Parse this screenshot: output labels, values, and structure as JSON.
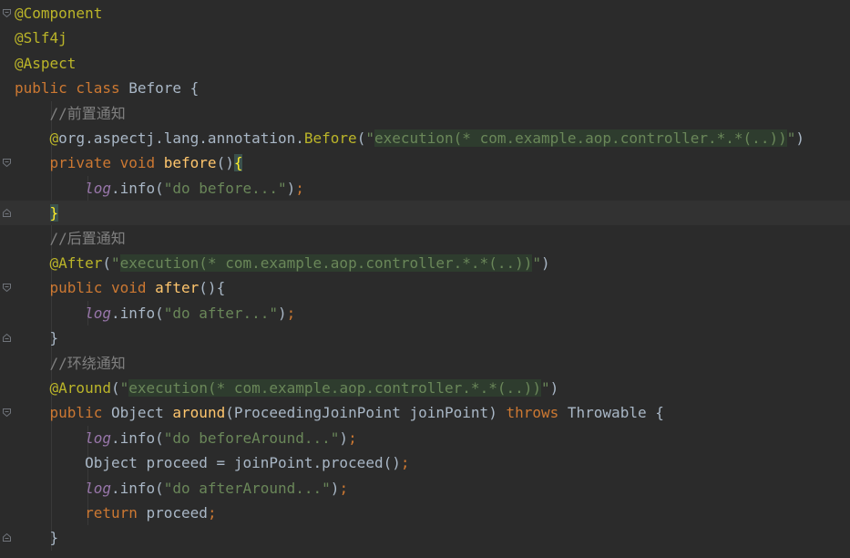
{
  "editor": {
    "lines": [
      {
        "tokens": [
          [
            "ann",
            "@Component"
          ]
        ]
      },
      {
        "tokens": [
          [
            "ann",
            "@Slf4j"
          ]
        ]
      },
      {
        "tokens": [
          [
            "ann",
            "@Aspect"
          ]
        ]
      },
      {
        "tokens": [
          [
            "kw",
            "public class "
          ],
          [
            "plain",
            "Before {"
          ]
        ]
      },
      {
        "tokens": [
          [
            "plain",
            "    "
          ],
          [
            "comment",
            "//前置通知"
          ]
        ]
      },
      {
        "tokens": [
          [
            "plain",
            "    "
          ],
          [
            "ann",
            "@"
          ],
          [
            "plain",
            "org.aspectj.lang.annotation."
          ],
          [
            "ann",
            "Before"
          ],
          [
            "plain",
            "("
          ],
          [
            "str",
            "\""
          ],
          [
            "strbg",
            "execution(* com.example.aop.controller.*.*(..))"
          ],
          [
            "str",
            "\""
          ],
          [
            "plain",
            ")"
          ]
        ]
      },
      {
        "tokens": [
          [
            "plain",
            "    "
          ],
          [
            "kw",
            "private void "
          ],
          [
            "method",
            "before"
          ],
          [
            "plain",
            "()"
          ],
          [
            "match",
            "{"
          ]
        ]
      },
      {
        "tokens": [
          [
            "plain",
            "        "
          ],
          [
            "field",
            "log"
          ],
          [
            "plain",
            ".info("
          ],
          [
            "str",
            "\"do before...\""
          ],
          [
            "plain",
            ")"
          ],
          [
            "kw",
            ";"
          ]
        ]
      },
      {
        "tokens": [
          [
            "plain",
            "    "
          ],
          [
            "match",
            "}"
          ]
        ]
      },
      {
        "tokens": [
          [
            "plain",
            "    "
          ],
          [
            "comment",
            "//后置通知"
          ]
        ]
      },
      {
        "tokens": [
          [
            "plain",
            "    "
          ],
          [
            "ann",
            "@After"
          ],
          [
            "plain",
            "("
          ],
          [
            "str",
            "\""
          ],
          [
            "strbg",
            "execution(* com.example.aop.controller.*.*(..))"
          ],
          [
            "str",
            "\""
          ],
          [
            "plain",
            ")"
          ]
        ]
      },
      {
        "tokens": [
          [
            "plain",
            "    "
          ],
          [
            "kw",
            "public void "
          ],
          [
            "method",
            "after"
          ],
          [
            "plain",
            "(){"
          ]
        ]
      },
      {
        "tokens": [
          [
            "plain",
            "        "
          ],
          [
            "field",
            "log"
          ],
          [
            "plain",
            ".info("
          ],
          [
            "str",
            "\"do after...\""
          ],
          [
            "plain",
            ")"
          ],
          [
            "kw",
            ";"
          ]
        ]
      },
      {
        "tokens": [
          [
            "plain",
            "    }"
          ]
        ]
      },
      {
        "tokens": [
          [
            "plain",
            "    "
          ],
          [
            "comment",
            "//环绕通知"
          ]
        ]
      },
      {
        "tokens": [
          [
            "plain",
            "    "
          ],
          [
            "ann",
            "@Around"
          ],
          [
            "plain",
            "("
          ],
          [
            "str",
            "\""
          ],
          [
            "strbg",
            "execution(* com.example.aop.controller.*.*(..))"
          ],
          [
            "str",
            "\""
          ],
          [
            "plain",
            ")"
          ]
        ]
      },
      {
        "tokens": [
          [
            "plain",
            "    "
          ],
          [
            "kw",
            "public "
          ],
          [
            "plain",
            "Object "
          ],
          [
            "method",
            "around"
          ],
          [
            "plain",
            "(ProceedingJoinPoint joinPoint) "
          ],
          [
            "kw",
            "throws "
          ],
          [
            "plain",
            "Throwable {"
          ]
        ]
      },
      {
        "tokens": [
          [
            "plain",
            "        "
          ],
          [
            "field",
            "log"
          ],
          [
            "plain",
            ".info("
          ],
          [
            "str",
            "\"do beforeAround...\""
          ],
          [
            "plain",
            ")"
          ],
          [
            "kw",
            ";"
          ]
        ]
      },
      {
        "tokens": [
          [
            "plain",
            "        Object proceed = joinPoint.proceed()"
          ],
          [
            "kw",
            ";"
          ]
        ]
      },
      {
        "tokens": [
          [
            "plain",
            "        "
          ],
          [
            "field",
            "log"
          ],
          [
            "plain",
            ".info("
          ],
          [
            "str",
            "\"do afterAround...\""
          ],
          [
            "plain",
            ")"
          ],
          [
            "kw",
            ";"
          ]
        ]
      },
      {
        "tokens": [
          [
            "plain",
            "        "
          ],
          [
            "kw",
            "return "
          ],
          [
            "plain",
            "proceed"
          ],
          [
            "kw",
            ";"
          ]
        ]
      },
      {
        "tokens": [
          [
            "plain",
            "    }"
          ]
        ]
      }
    ],
    "caret_line_index": 8,
    "fold_markers": [
      {
        "line": 0,
        "kind": "open"
      },
      {
        "line": 6,
        "kind": "open"
      },
      {
        "line": 8,
        "kind": "close"
      },
      {
        "line": 11,
        "kind": "open"
      },
      {
        "line": 13,
        "kind": "close"
      },
      {
        "line": 16,
        "kind": "open"
      },
      {
        "line": 21,
        "kind": "close"
      }
    ]
  },
  "colors": {
    "background": "#2b2b2b",
    "annotation": "#bbb529",
    "keyword": "#cc7832",
    "string": "#6a8759",
    "method": "#ffc66d",
    "field": "#9876aa",
    "comment": "#808080",
    "text": "#a9b7c6",
    "brace_match": "#ffef28"
  }
}
